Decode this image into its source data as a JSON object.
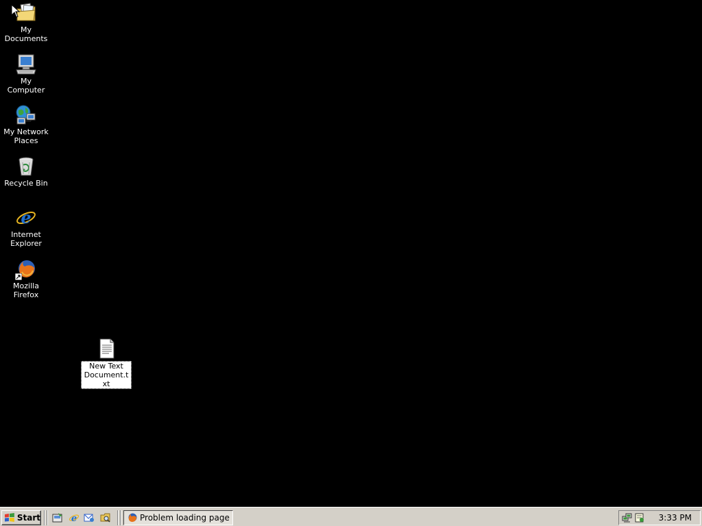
{
  "desktop": {
    "icons": [
      {
        "name": "my-documents",
        "label": "My Documents",
        "icon": "folder-documents-icon"
      },
      {
        "name": "my-computer",
        "label": "My Computer",
        "icon": "computer-icon"
      },
      {
        "name": "my-network-places",
        "label": "My Network Places",
        "icon": "network-icon"
      },
      {
        "name": "recycle-bin",
        "label": "Recycle Bin",
        "icon": "recycle-bin-icon"
      },
      {
        "name": "internet-explorer",
        "label": "Internet Explorer",
        "icon": "ie-icon"
      },
      {
        "name": "mozilla-firefox",
        "label": "Mozilla Firefox",
        "icon": "firefox-icon"
      }
    ],
    "file": {
      "label": "New Text Document.txt",
      "icon": "text-file-icon",
      "selected": true
    }
  },
  "taskbar": {
    "start_label": "Start",
    "quick_launch": [
      "show-desktop-icon",
      "ie-icon",
      "outlook-icon",
      "explorer-icon"
    ],
    "tasks": [
      {
        "label": "Problem loading page ...",
        "icon": "firefox-icon",
        "active": true
      }
    ],
    "tray": {
      "icons": [
        "network-tray-icon",
        "notepad-tray-icon"
      ],
      "clock": "3:33 PM"
    }
  },
  "colors": {
    "desktop_background": "#000000",
    "taskbar": "#d4d0c8"
  }
}
